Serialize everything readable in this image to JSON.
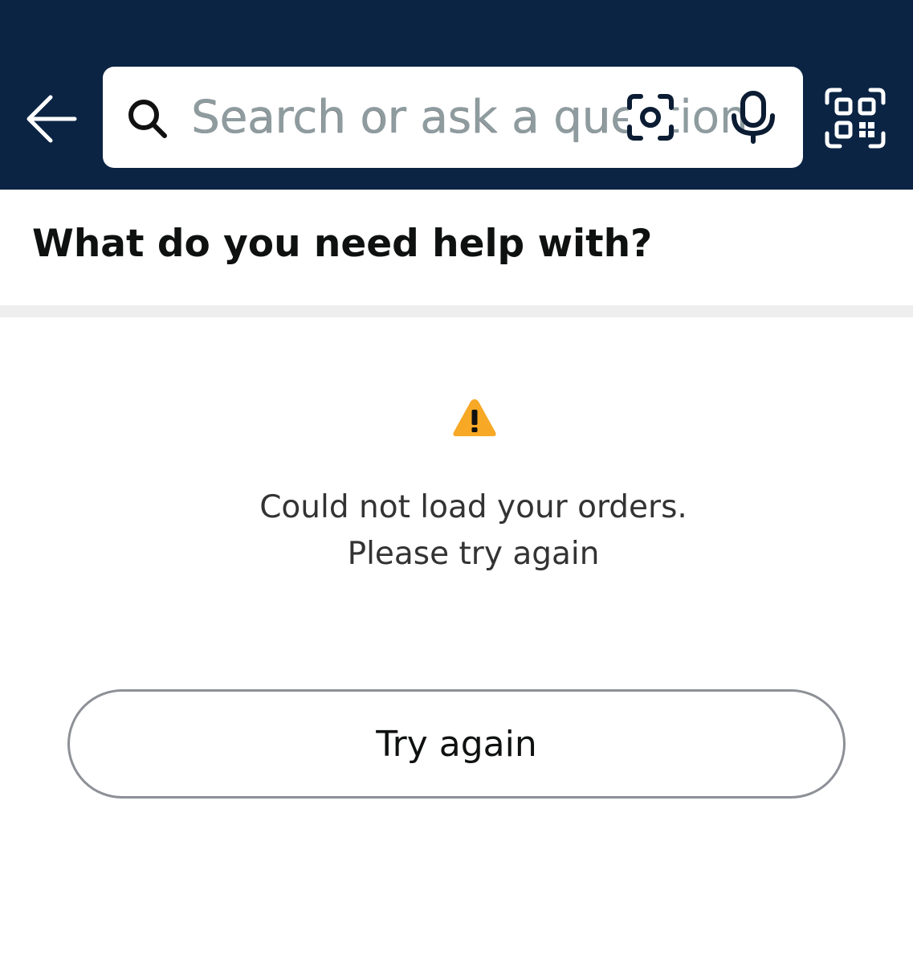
{
  "header": {
    "back_icon": "arrow-left-icon",
    "search": {
      "placeholder": "Search or ask a question",
      "search_icon": "search-icon",
      "camera_icon": "camera-scan-icon",
      "mic_icon": "microphone-icon"
    },
    "qr_icon": "qr-code-scan-icon",
    "background_color": "#0b2444"
  },
  "help": {
    "title": "What do you need help with?"
  },
  "error": {
    "icon": "warning-icon",
    "icon_color": "#f7a825",
    "line1": "Could not load your orders.",
    "line2": "Please try again"
  },
  "retry_button": {
    "label": "Try again"
  }
}
